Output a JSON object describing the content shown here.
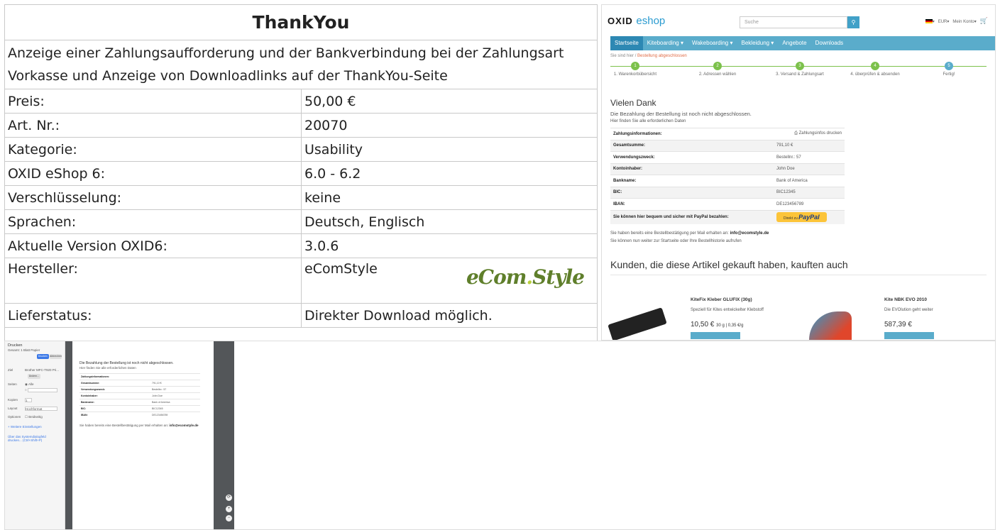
{
  "info": {
    "title": "ThankYou",
    "description": "Anzeige einer Zahlungsaufforderung und der Bankverbindung bei der Zahlungsart Vorkasse und Anzeige von Downloadlinks auf der ThankYou-Seite",
    "rows": [
      {
        "key": "Preis:",
        "value": "50,00 €"
      },
      {
        "key": "Art. Nr.:",
        "value": "20070"
      },
      {
        "key": "Kategorie:",
        "value": "Usability"
      },
      {
        "key": "OXID eShop 6:",
        "value": "6.0 - 6.2"
      },
      {
        "key": "Verschlüsselung:",
        "value": "keine"
      },
      {
        "key": "Sprachen:",
        "value": "Deutsch, Englisch"
      },
      {
        "key": "Aktuelle Version OXID6:",
        "value": "3.0.6"
      },
      {
        "key": "Hersteller:",
        "value": "eComStyle"
      },
      {
        "key": "Lieferstatus:",
        "value": "Direkter Download möglich."
      }
    ],
    "manufacturer_logo_a": "eCom",
    "manufacturer_logo_dot": ".",
    "manufacturer_logo_b": "Style"
  },
  "shop": {
    "logo_a": "OXID ",
    "logo_b": "eshop",
    "search_placeholder": "Suche",
    "currency": "EUR",
    "account": "Mein Konto",
    "nav": [
      "Startseite",
      "Kiteboarding ▾",
      "Wakeboarding ▾",
      "Bekleidung ▾",
      "Angebote",
      "Downloads"
    ],
    "crumb_prefix": "Sie sind hier",
    "crumb_current": "Bestellung abgeschlossen",
    "steps": [
      "1. Warenkorbübersicht",
      "2. Adressen wählen",
      "3. Versand & Zahlungsart",
      "4. überprüfen & absenden",
      "Fertig!"
    ],
    "step_numbers": [
      "1",
      "2",
      "3",
      "4",
      "5"
    ],
    "heading": "Vielen Dank",
    "subheading": "Die Bezahlung der Bestellung ist noch nicht abgeschlossen.",
    "hint": "Hier finden Sie alle erforderlichen Daten",
    "pay_header": "Zahlungsinformationen:",
    "print_link": "Zahlungsinfos drucken",
    "pay_rows": [
      {
        "key": "Gesamtsumme:",
        "value": "791,10 €"
      },
      {
        "key": "Verwendungszweck:",
        "value": "Bestellnr.: 57"
      },
      {
        "key": "Kontoinhaber:",
        "value": "John Doe"
      },
      {
        "key": "Bankname:",
        "value": "Bank of America"
      },
      {
        "key": "BIC:",
        "value": "BIC12345"
      },
      {
        "key": "IBAN:",
        "value": "DE123456789"
      }
    ],
    "paypal_text": "Sie können hier bequem und sicher mit PayPal bezahlen:",
    "paypal_btn_small": "Direkt zu",
    "paypal_btn_brand": "PayPal",
    "mail_note": "Sie haben bereits eine Bestellbestätigung per Mail erhalten an:",
    "mail_address": "info@ecomstyle.de",
    "continue_note": "Sie können nun weiter zur Startseite oder Ihre Bestellhistorie aufrufen",
    "related_heading": "Kunden, die diese Artikel gekauft haben, kauften auch",
    "products": [
      {
        "name": "KiteFix Kleber GLUFIX (30g)",
        "desc": "Speziell für Kites entwickelter Klebstoff",
        "price": "10,50 €",
        "unit": "30 g | 0,35 €/g"
      },
      {
        "name": "Kite NBK EVO 2010",
        "desc": "Die EVOlution geht weiter",
        "price": "587,39 €",
        "unit": ""
      }
    ]
  },
  "print": {
    "title": "Drucken",
    "sheets": "Gesamt: 1 Blatt Papier",
    "print_btn": "Drucken",
    "cancel_btn": "Abbrechen",
    "target_label": "Ziel",
    "target_value": "Brother MFC-T920 Pri...",
    "change_btn": "Ändern...",
    "pages_label": "Seiten",
    "pages_all": "Alle",
    "pages_example": "z.B. 1-5, 8, 11-13",
    "copies_label": "Kopien",
    "copies_value": "1",
    "layout_label": "Layout",
    "layout_value": "Hochformat",
    "options_label": "Optionen",
    "options_value": "Beidseitig",
    "more_settings": "Weitere Einstellungen",
    "system_dialog": "Über das Systemdialogfeld drucken... (Ctrl+Shift+P)",
    "page_heading": "Die Bezahlung der Bestellung ist noch nicht abgeschlossen.",
    "page_hint": "Hier finden Sie alle erforderlichen Daten",
    "page_pay_header": "Zahlungsinformationen:",
    "page_rows": [
      {
        "key": "Gesamtsumme:",
        "value": "791,10 €"
      },
      {
        "key": "Verwendungszweck:",
        "value": "Bestellnr.: 57"
      },
      {
        "key": "Kontoinhaber:",
        "value": "John Doe"
      },
      {
        "key": "Bankname:",
        "value": "Bank of America"
      },
      {
        "key": "BIC:",
        "value": "BIC12345"
      },
      {
        "key": "IBAN:",
        "value": "DE123456789"
      }
    ],
    "page_mail_note": "Sie haben bereits eine Bestellbestätigung per Mail erhalten an:",
    "page_mail": "info@ecomstyle.de",
    "zoom_buttons": [
      "⟳",
      "+",
      "−"
    ]
  }
}
